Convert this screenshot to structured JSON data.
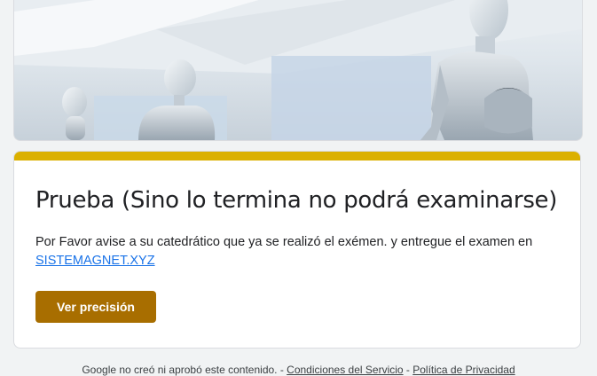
{
  "banner": {
    "image": "mannequins-in-office-photo"
  },
  "card": {
    "title": "Prueba (Sino lo termina no podrá examinarse)",
    "description": "Por Favor avise a su catedrático que ya se realizó el exémen. y entregue el examen en",
    "link_text": "SISTEMAGNET.XYZ",
    "button_label": "Ver precisión",
    "accent_color": "#dbb000",
    "button_color": "#a86e00"
  },
  "footer": {
    "disclaimer": "Google no creó ni aprobó este contenido.",
    "sep1": " - ",
    "terms_link": "Condiciones del Servicio",
    "sep2": " - ",
    "privacy_link": "Política de Privacidad"
  }
}
